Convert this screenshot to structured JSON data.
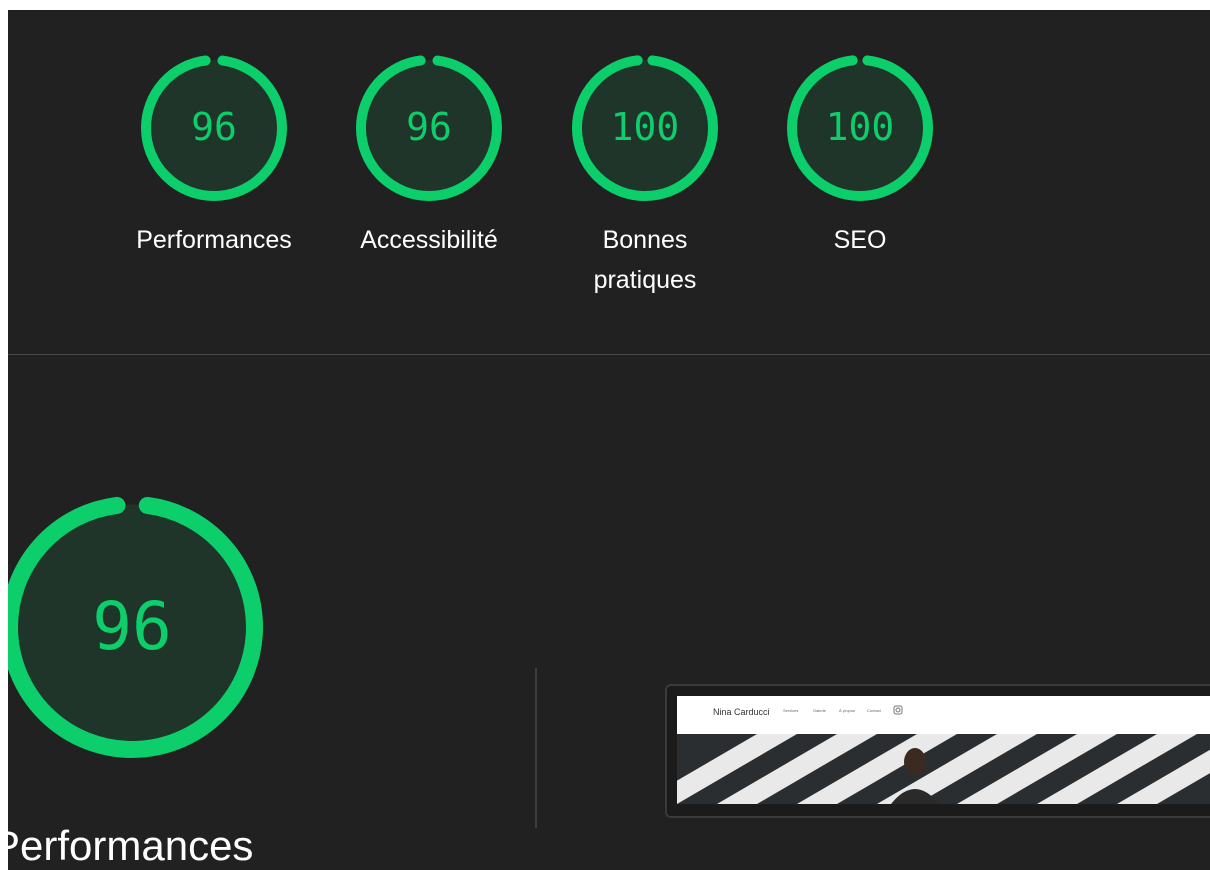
{
  "summary_gauges": [
    {
      "score": "96",
      "label_lines": [
        "Performances"
      ],
      "value": 96
    },
    {
      "score": "96",
      "label_lines": [
        "Accessibilité"
      ],
      "value": 96
    },
    {
      "score": "100",
      "label_lines": [
        "Bonnes",
        "pratiques"
      ],
      "value": 100
    },
    {
      "score": "100",
      "label_lines": [
        "SEO"
      ],
      "value": 100
    }
  ],
  "main_gauge": {
    "score": "96",
    "value": 96
  },
  "section": {
    "title": "Performances"
  },
  "screenshot_preview": {
    "site_name": "Nina Carducci",
    "nav_links": [
      "Services",
      "Galerie",
      "À propos",
      "Contact"
    ]
  },
  "colors": {
    "pass": "#0cce6b",
    "gauge_fill": "#1f3529",
    "background": "#212121"
  }
}
